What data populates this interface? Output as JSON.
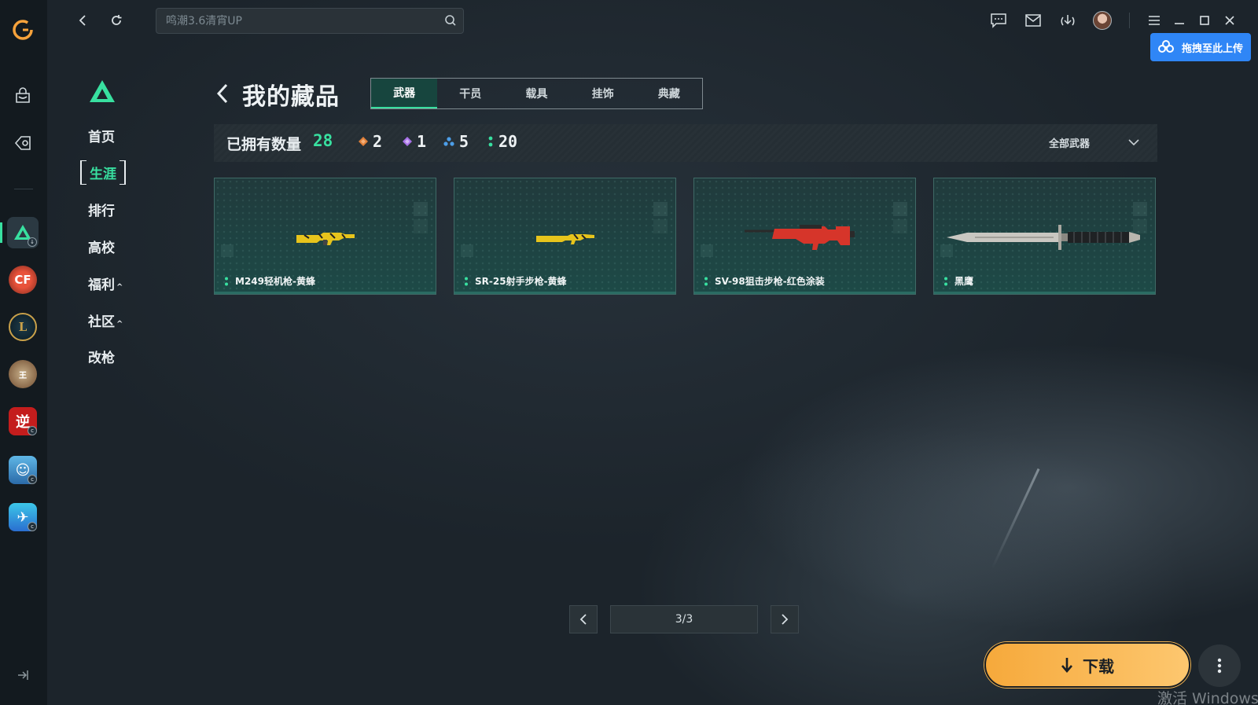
{
  "search": {
    "placeholder": "鸣潮3.6清宵UP"
  },
  "upload": {
    "label": "拖拽至此上传"
  },
  "nav": {
    "items": [
      {
        "label": "首页",
        "caret": ""
      },
      {
        "label": "生涯",
        "caret": ""
      },
      {
        "label": "排行",
        "caret": ""
      },
      {
        "label": "高校",
        "caret": ""
      },
      {
        "label": "福利",
        "caret": "^"
      },
      {
        "label": "社区",
        "caret": "^"
      },
      {
        "label": "改枪",
        "caret": ""
      }
    ]
  },
  "header": {
    "title": "我的藏品",
    "tabs": [
      "武器",
      "干员",
      "载具",
      "挂饰",
      "典藏"
    ],
    "active_tab": 0
  },
  "stats": {
    "label": "已拥有数量",
    "total": "28",
    "rarity": [
      {
        "color": "#e0803a",
        "count": "2"
      },
      {
        "color": "#a872e8",
        "count": "1"
      },
      {
        "color": "#4c9ee8",
        "count": "5"
      },
      {
        "color": "#38e0a0",
        "count": "20"
      }
    ],
    "filter": "全部武器"
  },
  "cards": [
    {
      "name": "M249轻机枪-黄蜂",
      "weapon_icon": "lmg-yellow-icon"
    },
    {
      "name": "SR-25射手步枪-黄蜂",
      "weapon_icon": "rifle-yellow-icon"
    },
    {
      "name": "SV-98狙击步枪-红色涂装",
      "weapon_icon": "sniper-red-icon"
    },
    {
      "name": "黑鹰",
      "weapon_icon": "knife-icon"
    }
  ],
  "pagination": {
    "text": "3/3"
  },
  "download": {
    "label": "下载"
  },
  "watermark": "激活 Windows",
  "colors": {
    "accent": "#38e0a0",
    "download": "#f8b24c",
    "upload": "#2f86f6"
  }
}
